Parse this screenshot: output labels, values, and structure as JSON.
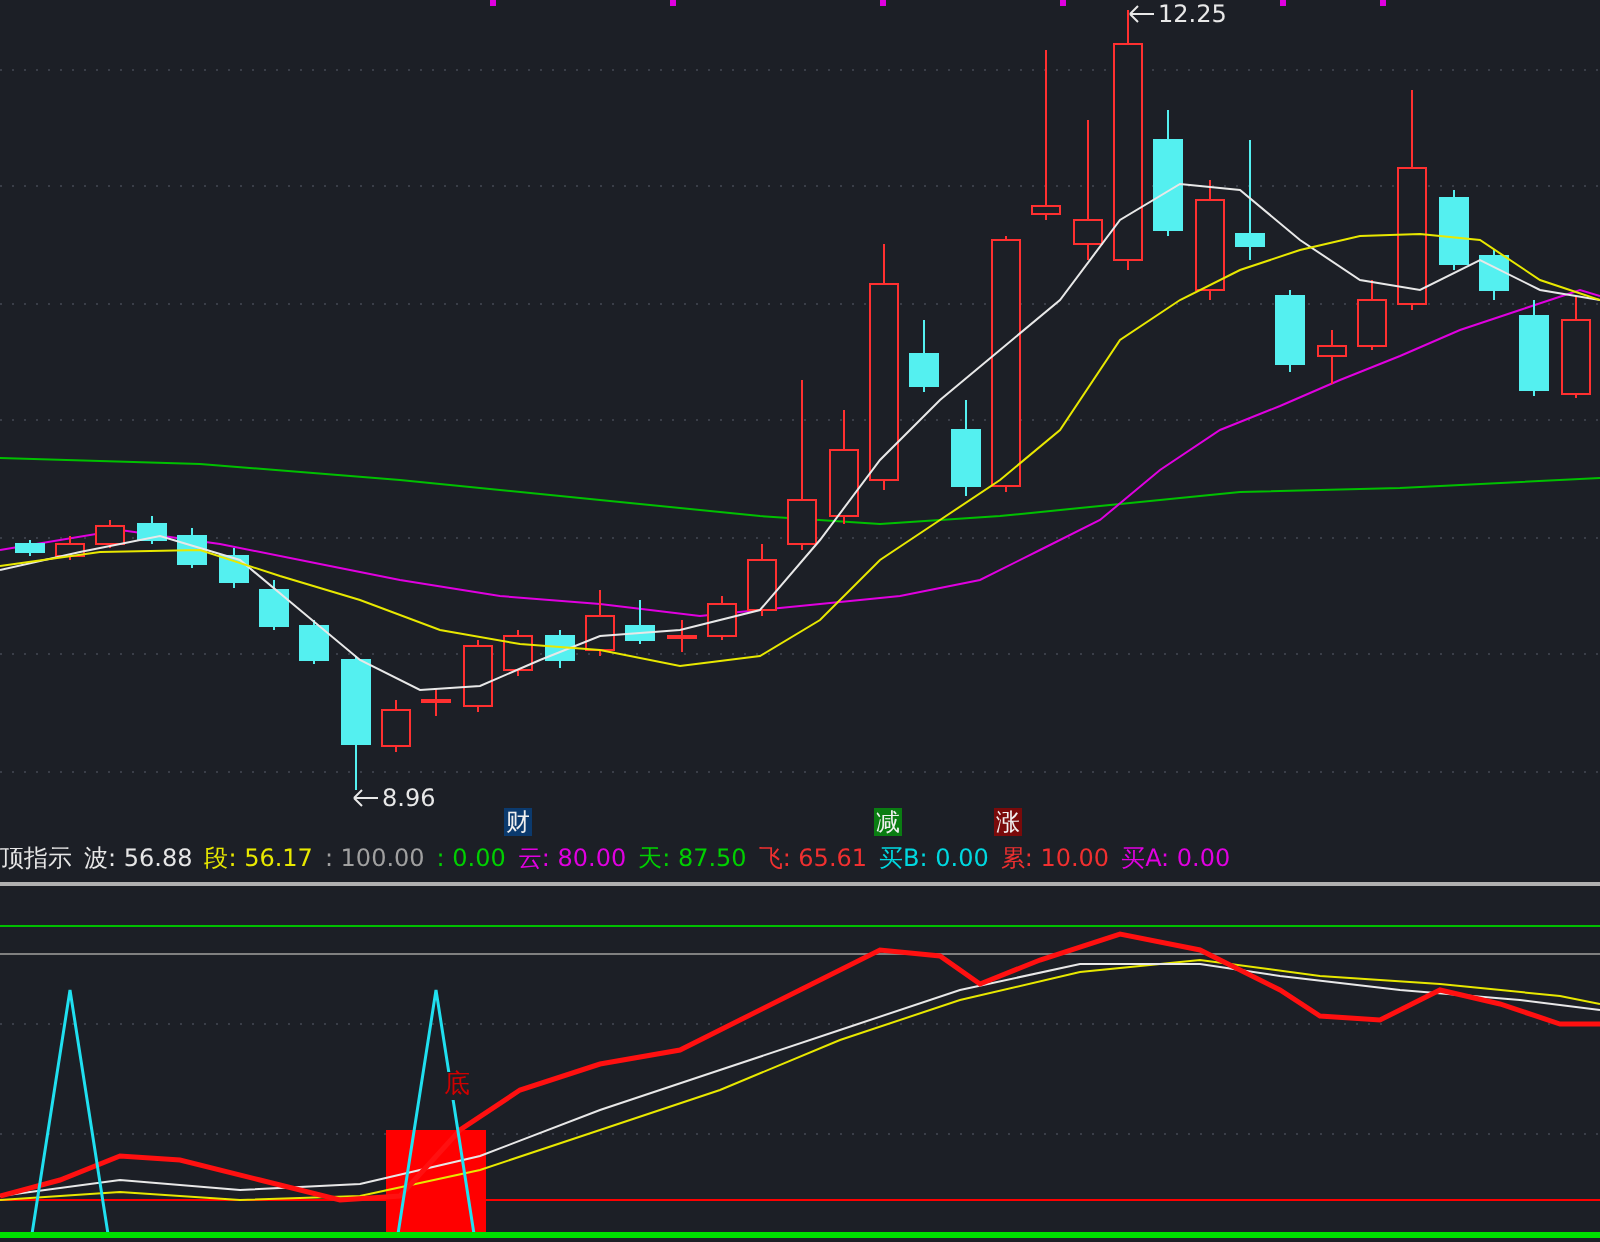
{
  "price_chart": {
    "high_label": "12.25",
    "low_label": "8.96",
    "markers": [
      {
        "label": "财",
        "color": "#0b3a6e"
      },
      {
        "label": "减",
        "color": "#0a7d12"
      },
      {
        "label": "涨",
        "color": "#7a0a0a"
      }
    ]
  },
  "indicator": {
    "name": "顶指示",
    "readings": [
      {
        "text": "波: 56.88",
        "color": "#e6e6e6"
      },
      {
        "text": "段: 56.17",
        "color": "#e8e800"
      },
      {
        "text": ": 100.00",
        "color": "#a0a0a0"
      },
      {
        "text": ": 0.00",
        "color": "#00d000"
      },
      {
        "text": "云: 80.00",
        "color": "#e000e0"
      },
      {
        "text": "天: 87.50",
        "color": "#00d000"
      },
      {
        "text": "飞: 65.61",
        "color": "#f03030"
      },
      {
        "text": "买B: 0.00",
        "color": "#00d8e0"
      },
      {
        "text": "累: 10.00",
        "color": "#f03030"
      },
      {
        "text": "买A: 0.00",
        "color": "#e000e0"
      }
    ]
  },
  "oscillator": {
    "signal_label": "底"
  }
}
